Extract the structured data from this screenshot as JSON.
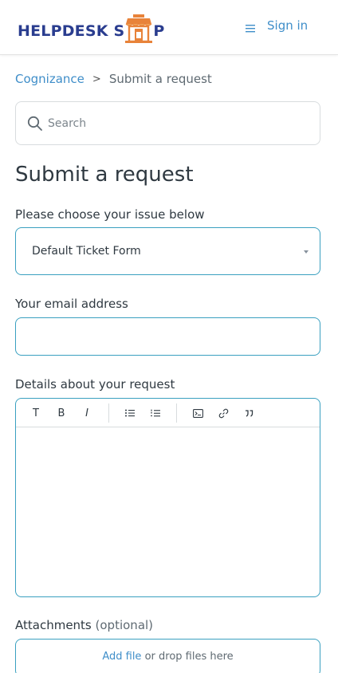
{
  "header": {
    "logo_text_left": "HELPDESK S",
    "logo_text_right": "P",
    "logo_alt": "HELPDESK SHOP",
    "menu_icon": "hamburger-icon",
    "signin_label": "Sign in"
  },
  "breadcrumb": {
    "link": "Cognizance",
    "separator": ">",
    "current": "Submit a request"
  },
  "search": {
    "placeholder": "Search",
    "icon": "search-icon"
  },
  "page": {
    "title": "Submit a request"
  },
  "form": {
    "issue_label": "Please choose your issue below",
    "issue_value": "Default Ticket Form",
    "email_label": "Your email address",
    "email_value": "",
    "details_label": "Details about your request",
    "toolbar": {
      "text": "T",
      "bold": "B",
      "italic": "I"
    },
    "attachments_label": "Attachments",
    "attachments_optional": "(optional)",
    "add_file": "Add file",
    "drop_text": "or drop files here"
  },
  "colors": {
    "accent": "#3f8ec9",
    "border_focus": "#3aa0c0",
    "logo_blue": "#2a3d8f",
    "logo_orange": "#e8833a"
  }
}
